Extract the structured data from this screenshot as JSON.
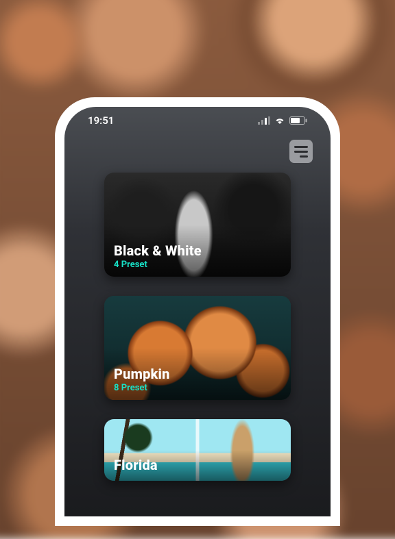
{
  "statusbar": {
    "time": "19:51"
  },
  "accent_color": "#17e0c6",
  "cards": [
    {
      "title": "Black & White",
      "subtitle": "4 Preset"
    },
    {
      "title": "Pumpkin",
      "subtitle": "8 Preset"
    },
    {
      "title": "Florida",
      "subtitle": ""
    }
  ]
}
